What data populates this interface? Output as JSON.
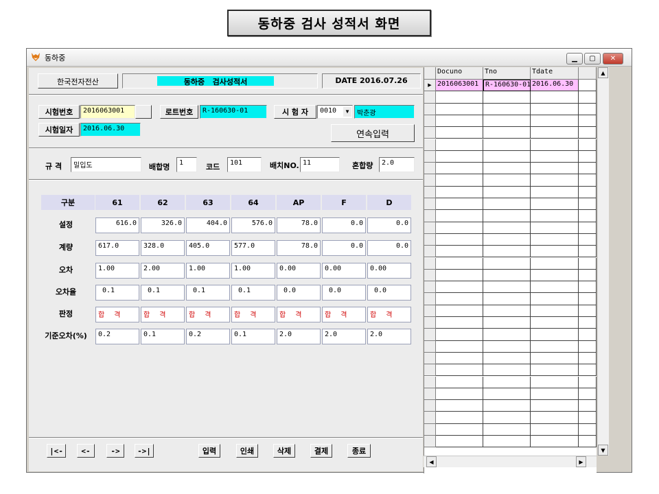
{
  "banner": "동하중 검사 성적서 화면",
  "window": {
    "title": "동하중"
  },
  "header": {
    "company": "한국전자전산",
    "doc_title": "동하중   검사성적서",
    "date": "DATE 2016.07.26"
  },
  "info": {
    "test_no_label": "시험번호",
    "test_no_value": "2016063001",
    "lot_no_label": "로트번호",
    "lot_no_value": "R-160630-01",
    "tester_label": "시 험 자",
    "tester_code": "0010",
    "tester_name": "박춘광",
    "test_date_label": "시험일자",
    "test_date_value": "2016.06.30",
    "continuous_input": "연속입력"
  },
  "spec": {
    "spec_label": "규  격",
    "spec_value": "밀입도",
    "mix_label": "배합명",
    "mix_value": "1",
    "code_label": "코드",
    "code_value": "101",
    "batch_label": "배치NO.",
    "batch_value": "11",
    "blend_label": "혼합량",
    "blend_value": "2.0"
  },
  "table": {
    "corner": "구분",
    "columns": [
      "61",
      "62",
      "63",
      "64",
      "AP",
      "F",
      "D"
    ],
    "rows": [
      {
        "label": "설정",
        "align": "right",
        "values": [
          "616.0",
          "326.0",
          "404.0",
          "576.0",
          "78.0",
          "0.0",
          "0.0"
        ]
      },
      {
        "label": "계량",
        "align": "mixed",
        "values": [
          "617.0",
          "328.0",
          "405.0",
          "577.0",
          "78.0",
          "0.0",
          "0.0"
        ]
      },
      {
        "label": "오차",
        "align": "left",
        "values": [
          "1.00",
          "2.00",
          "1.00",
          "1.00",
          "0.00",
          "0.00",
          "0.00"
        ]
      },
      {
        "label": "오차율",
        "align": "left",
        "values": [
          " 0.1",
          " 0.1",
          " 0.1",
          " 0.1",
          " 0.0",
          " 0.0",
          " 0.0"
        ]
      },
      {
        "label": "판정",
        "align": "pass",
        "values": [
          "합 격",
          "합 격",
          "합 격",
          "합 격",
          "합 격",
          "합 격",
          "합 격"
        ]
      },
      {
        "label": "기준오차(%)",
        "align": "left",
        "values": [
          "0.2",
          "0.1",
          "0.2",
          "0.1",
          "2.0",
          "2.0",
          "2.0"
        ]
      }
    ]
  },
  "nav": {
    "first": "|<-",
    "prev": "<-",
    "next": "->",
    "last": "->|"
  },
  "actions": {
    "input": "입력",
    "print": "인쇄",
    "delete": "삭제",
    "approve": "결제",
    "exit": "종료"
  },
  "grid": {
    "columns": [
      "Docuno",
      "Tno",
      "Tdate"
    ],
    "rows": [
      [
        "2016063001",
        "R-160630-01",
        "2016.06.30"
      ]
    ],
    "selected_bg": "#ffc0ff"
  }
}
